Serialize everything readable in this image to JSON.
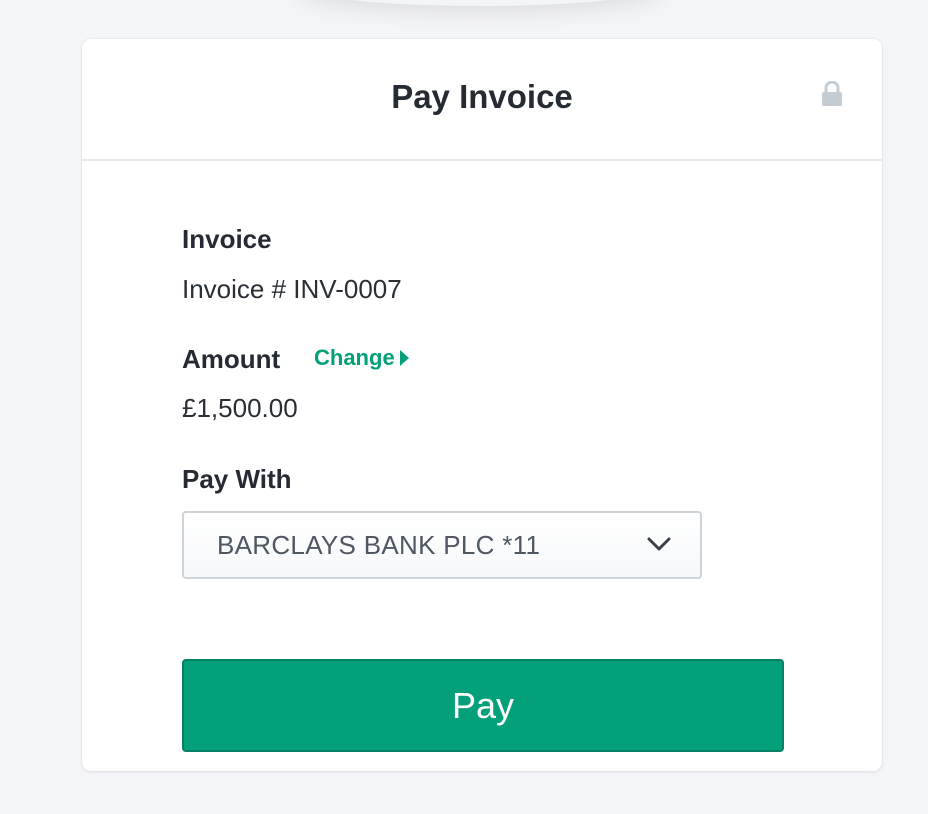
{
  "header": {
    "title": "Pay Invoice",
    "icon": "lock-icon"
  },
  "invoice": {
    "label": "Invoice",
    "value": "Invoice # INV-0007"
  },
  "amount": {
    "label": "Amount",
    "change_label": "Change",
    "change_icon": "caret-right-icon",
    "value": "£1,500.00"
  },
  "pay_with": {
    "label": "Pay With",
    "selected": "BARCLAYS BANK PLC *11",
    "icon": "chevron-down-icon"
  },
  "actions": {
    "pay_label": "Pay"
  },
  "colors": {
    "accent": "#03a07a",
    "background": "#f4f5f9",
    "text": "#262b33",
    "lock": "#c5cbd3"
  }
}
